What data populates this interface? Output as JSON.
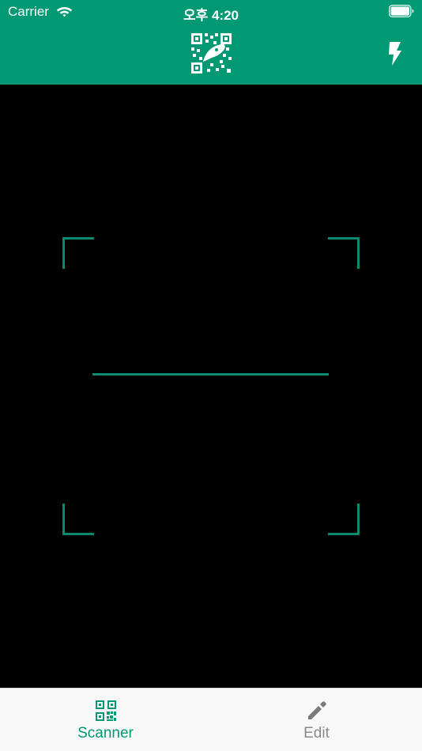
{
  "status_bar": {
    "carrier": "Carrier",
    "time": "오후 4:20",
    "wifi_icon": "wifi-icon",
    "battery_icon": "battery-icon"
  },
  "header": {
    "background": "#019973",
    "logo_icon": "qr-code-logo-icon",
    "flash_icon": "flash-icon"
  },
  "scanner": {
    "frame_color": "#0a8b6d",
    "background": "#000000"
  },
  "tab_bar": {
    "tabs": [
      {
        "label": "Scanner",
        "icon": "qr-code-icon",
        "active": true,
        "color": "#019973"
      },
      {
        "label": "Edit",
        "icon": "pencil-icon",
        "active": false,
        "color": "#8a8a8a"
      }
    ]
  }
}
